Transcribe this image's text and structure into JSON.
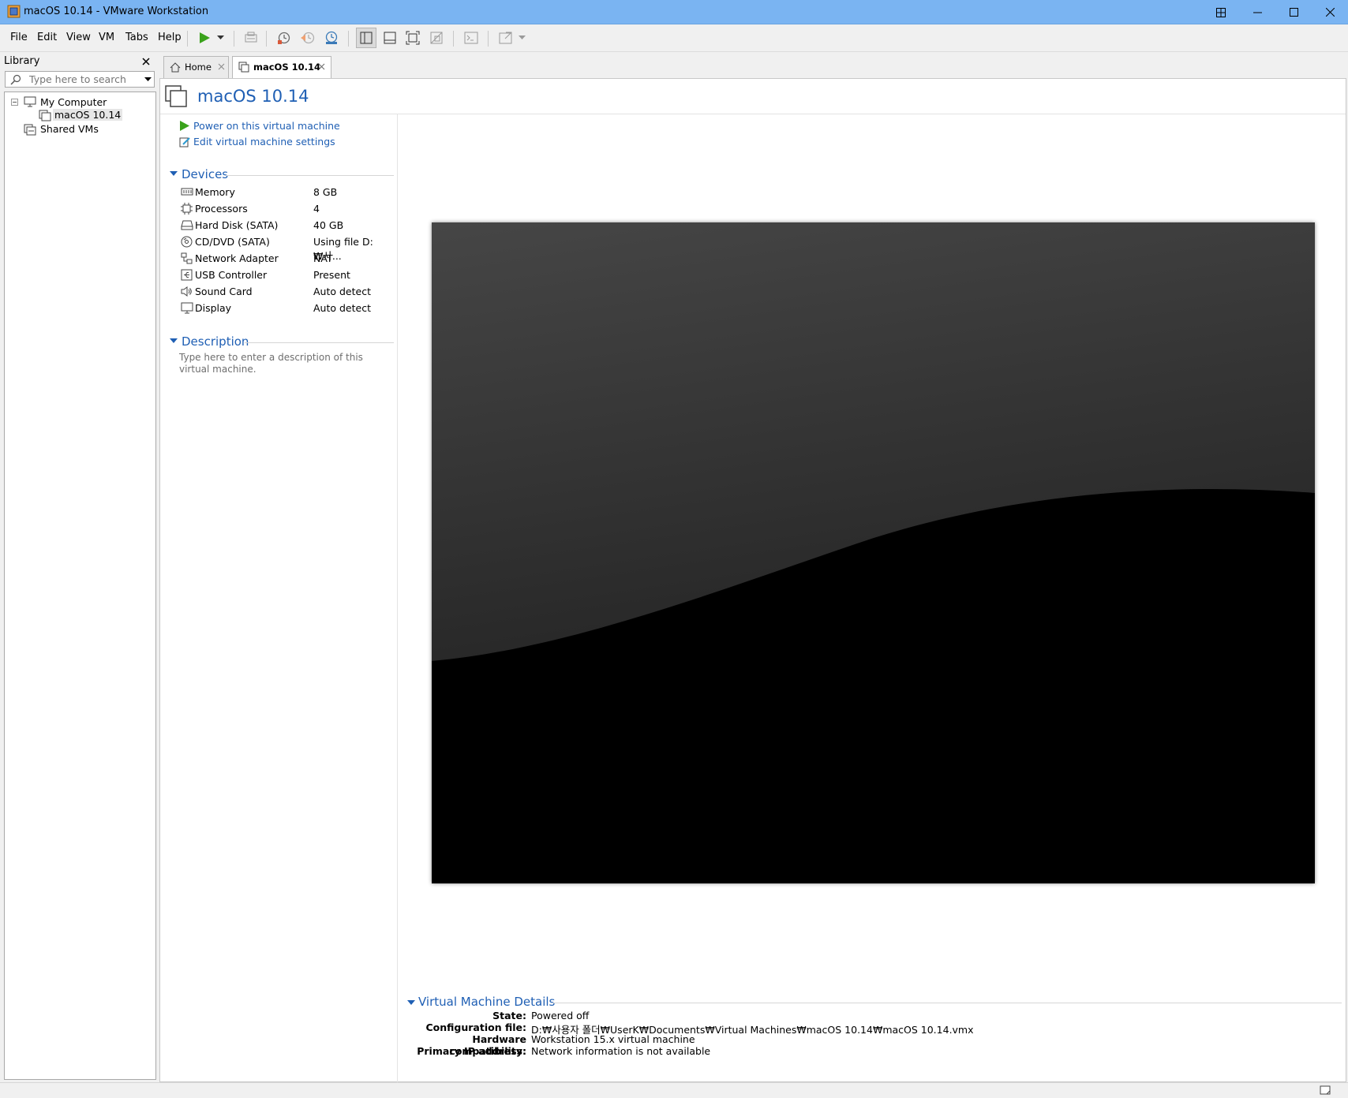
{
  "window": {
    "title": "macOS 10.14 - VMware Workstation"
  },
  "menu": [
    "File",
    "Edit",
    "View",
    "VM",
    "Tabs",
    "Help"
  ],
  "library": {
    "title": "Library",
    "search_placeholder": "Type here to search",
    "tree": {
      "my_computer": "My Computer",
      "vm": "macOS 10.14",
      "shared": "Shared VMs"
    }
  },
  "tabs": [
    {
      "label": "Home"
    },
    {
      "label": "macOS 10.14"
    }
  ],
  "vm": {
    "name": "macOS 10.14",
    "actions": {
      "power_on": "Power on this virtual machine",
      "edit_settings": "Edit virtual machine settings"
    },
    "devices_title": "Devices",
    "devices": [
      {
        "icon": "memory-icon",
        "label": "Memory",
        "value": "8 GB"
      },
      {
        "icon": "cpu-icon",
        "label": "Processors",
        "value": "4"
      },
      {
        "icon": "hard-disk-icon",
        "label": "Hard Disk (SATA)",
        "value": "40 GB"
      },
      {
        "icon": "cd-dvd-icon",
        "label": "CD/DVD (SATA)",
        "value": "Using file D:₩사..."
      },
      {
        "icon": "network-icon",
        "label": "Network Adapter",
        "value": "NAT"
      },
      {
        "icon": "usb-icon",
        "label": "USB Controller",
        "value": "Present"
      },
      {
        "icon": "sound-icon",
        "label": "Sound Card",
        "value": "Auto detect"
      },
      {
        "icon": "display-icon",
        "label": "Display",
        "value": "Auto detect"
      }
    ],
    "description_title": "Description",
    "description_placeholder": "Type here to enter a description of this virtual machine.",
    "details_title": "Virtual Machine Details",
    "details": [
      {
        "key": "State:",
        "value": "Powered off"
      },
      {
        "key": "Configuration file:",
        "value": "D:₩사용자 폴더₩UserK₩Documents₩Virtual Machines₩macOS 10.14₩macOS 10.14.vmx"
      },
      {
        "key": "Hardware compatibility:",
        "value": "Workstation 15.x virtual machine"
      },
      {
        "key": "Primary IP address:",
        "value": "Network information is not available"
      }
    ]
  },
  "colors": {
    "titlebar": "#7ab4f2",
    "link": "#1f5fb4",
    "play_green": "#3aa21b"
  }
}
